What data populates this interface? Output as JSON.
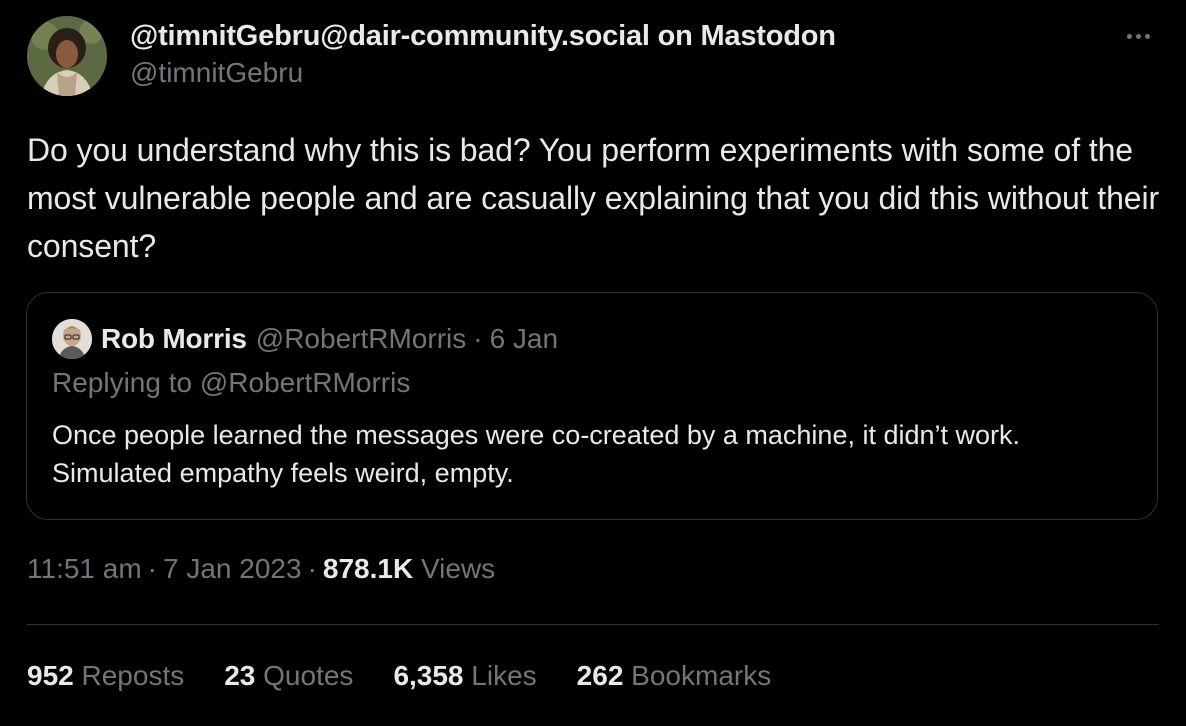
{
  "author": {
    "display_name": "@timnitGebru@dair-community.social on Mastodon",
    "handle": "@timnitGebru"
  },
  "tweet": {
    "text": "Do you understand why this is bad? You perform experiments with some of the most vulnerable people and are casually explaining that you did this without their consent?"
  },
  "quote": {
    "name": "Rob Morris",
    "handle": "@RobertRMorris",
    "separator": "·",
    "date": "6 Jan",
    "replying_to": "Replying to @RobertRMorris",
    "text": "Once people learned the messages were co-created by a machine, it didn’t work. Simulated empathy feels weird, empty."
  },
  "meta": {
    "time": "11:51 am",
    "separator": "·",
    "date": "7 Jan 2023",
    "views_count": "878.1K",
    "views_label": "Views"
  },
  "stats": [
    {
      "count": "952",
      "label": "Reposts"
    },
    {
      "count": "23",
      "label": "Quotes"
    },
    {
      "count": "6,358",
      "label": "Likes"
    },
    {
      "count": "262",
      "label": "Bookmarks"
    }
  ],
  "icons": {
    "more": "more-horizontal-icon"
  },
  "colors": {
    "background": "#000000",
    "text_primary": "#e7e9ea",
    "text_secondary": "#71767b",
    "border": "#2f3336"
  }
}
